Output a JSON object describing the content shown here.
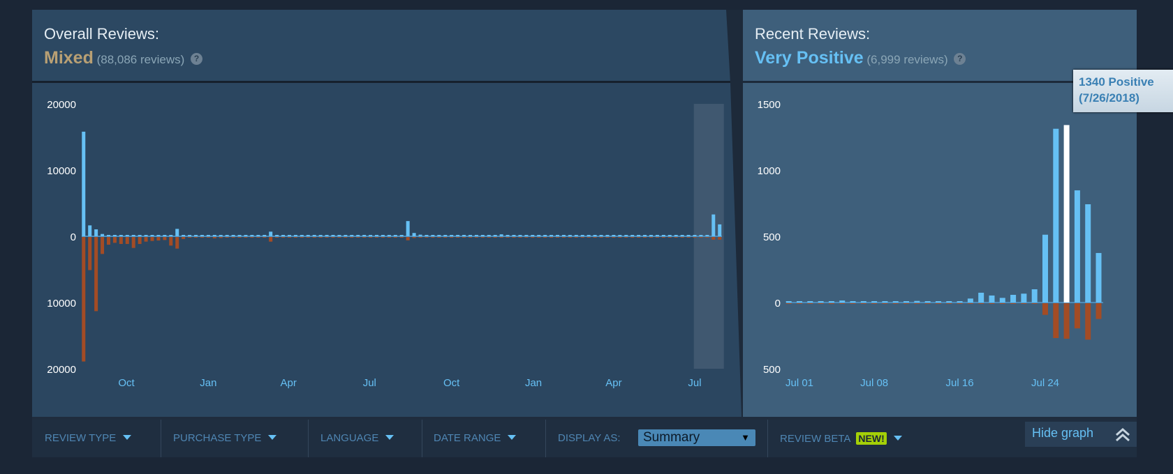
{
  "overall": {
    "title": "Overall Reviews:",
    "rating": "Mixed",
    "count_text": "(88,086 reviews)",
    "help_icon": "question-circle-icon",
    "rating_color": "#b9a074"
  },
  "recent": {
    "title": "Recent Reviews:",
    "rating": "Very Positive",
    "count_text": "(6,999 reviews)",
    "help_icon": "question-circle-icon",
    "rating_color": "#66c0f4"
  },
  "tooltip": {
    "line1": "1340 Positive",
    "line2": "(7/26/2018)"
  },
  "filters": {
    "review_type": "REVIEW TYPE",
    "purchase_type": "PURCHASE TYPE",
    "language": "LANGUAGE",
    "date_range": "DATE RANGE",
    "display_as_label": "DISPLAY AS:",
    "display_as_value": "Summary",
    "review_beta": "REVIEW BETA",
    "new_badge": "NEW!",
    "hide_graph": "Hide graph"
  },
  "colors": {
    "positive": "#66c0f4",
    "negative": "#a34c25",
    "highlight": "#ffffff",
    "background": "#1b2636"
  },
  "chart_data": [
    {
      "type": "bar",
      "title": "",
      "bar_interval": "week",
      "first_bar": "2016-08-14",
      "y_ticks": [
        "20000",
        "10000",
        "0",
        "10000",
        "20000"
      ],
      "ylim": [
        -20000,
        20000
      ],
      "x_ticks": [
        "Oct",
        "Jan",
        "Apr",
        "Jul",
        "Oct",
        "Jan",
        "Apr",
        "Jul"
      ],
      "x_tick_dates": [
        "2016-10-01",
        "2017-01-01",
        "2017-04-01",
        "2017-07-01",
        "2017-10-01",
        "2018-01-01",
        "2018-04-01",
        "2018-07-01"
      ],
      "selected_range": [
        "2018-06-30",
        "2018-07-29"
      ],
      "positive": [
        15800,
        1650,
        1050,
        350,
        150,
        100,
        80,
        80,
        80,
        80,
        70,
        70,
        60,
        60,
        70,
        1120,
        200,
        100,
        90,
        90,
        80,
        80,
        80,
        70,
        70,
        70,
        60,
        60,
        60,
        60,
        700,
        90,
        80,
        80,
        70,
        70,
        70,
        60,
        60,
        60,
        60,
        60,
        60,
        60,
        60,
        60,
        60,
        60,
        60,
        60,
        60,
        80,
        2300,
        500,
        250,
        120,
        100,
        90,
        80,
        80,
        80,
        70,
        70,
        70,
        70,
        70,
        80,
        300,
        70,
        60,
        60,
        60,
        60,
        60,
        60,
        60,
        60,
        60,
        60,
        60,
        60,
        60,
        60,
        60,
        60,
        60,
        60,
        60,
        60,
        60,
        60,
        60,
        60,
        60,
        60,
        60,
        60,
        60,
        60,
        60,
        80,
        3300,
        1800
      ],
      "negative": [
        18800,
        5000,
        11200,
        2560,
        1160,
        880,
        1050,
        1050,
        1650,
        1050,
        700,
        600,
        530,
        460,
        1300,
        1750,
        300,
        80,
        70,
        60,
        60,
        200,
        150,
        60,
        50,
        50,
        50,
        40,
        40,
        40,
        700,
        50,
        50,
        50,
        50,
        50,
        50,
        40,
        40,
        40,
        40,
        40,
        40,
        40,
        40,
        40,
        40,
        40,
        40,
        40,
        40,
        40,
        500,
        150,
        80,
        50,
        50,
        50,
        50,
        50,
        50,
        50,
        50,
        50,
        50,
        50,
        50,
        60,
        40,
        40,
        40,
        40,
        40,
        40,
        40,
        40,
        40,
        40,
        40,
        40,
        40,
        40,
        40,
        40,
        40,
        40,
        40,
        40,
        40,
        40,
        40,
        40,
        40,
        40,
        40,
        40,
        40,
        40,
        40,
        40,
        40,
        400,
        400
      ]
    },
    {
      "type": "bar",
      "title": "",
      "bar_interval": "day",
      "first_bar": "2018-06-30",
      "y_ticks": [
        "1500",
        "1000",
        "500",
        "0",
        "500"
      ],
      "ylim": [
        -500,
        1500
      ],
      "x_ticks": [
        "Jul 01",
        "Jul 08",
        "Jul 16",
        "Jul 24"
      ],
      "x_tick_dates": [
        "2018-07-01",
        "2018-07-08",
        "2018-07-16",
        "2018-07-24"
      ],
      "highlighted": "2018-07-26",
      "positive": [
        8,
        8,
        8,
        8,
        8,
        15,
        8,
        8,
        8,
        10,
        8,
        8,
        12,
        8,
        8,
        8,
        8,
        30,
        74,
        53,
        35,
        58,
        67,
        100,
        512,
        1312,
        1340,
        847,
        742,
        374
      ],
      "negative": [
        5,
        3,
        3,
        4,
        6,
        3,
        3,
        3,
        3,
        3,
        3,
        3,
        3,
        3,
        3,
        3,
        3,
        3,
        3,
        3,
        4,
        3,
        4,
        3,
        88,
        263,
        268,
        190,
        275,
        119
      ]
    }
  ]
}
